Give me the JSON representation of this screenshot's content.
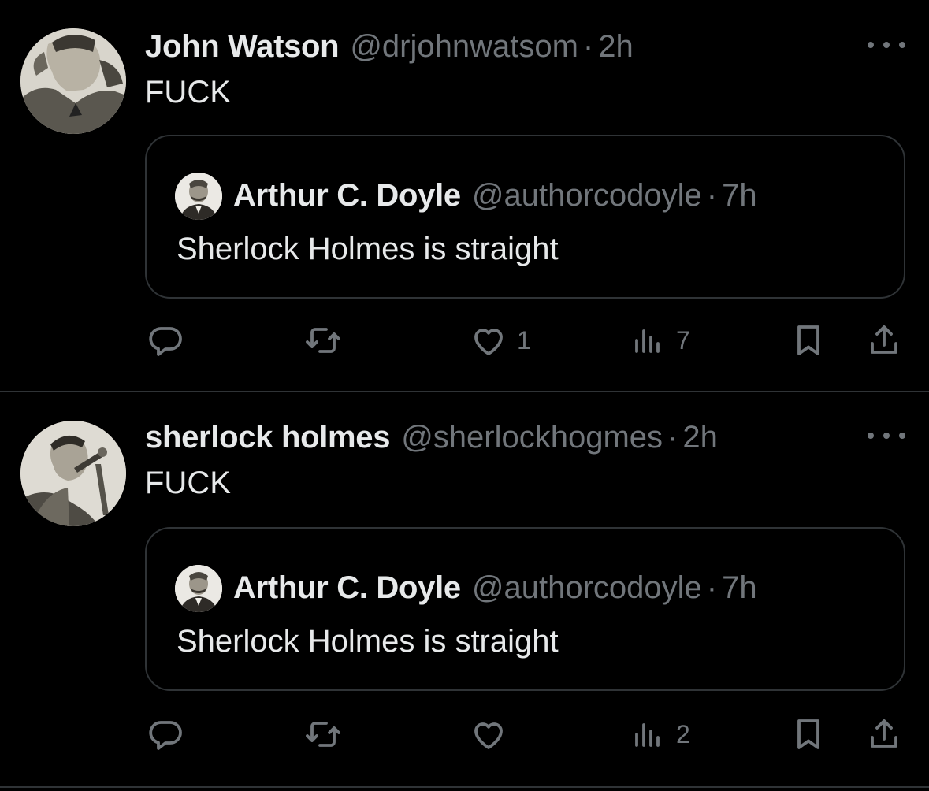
{
  "tweets": [
    {
      "author_name": "John Watson",
      "handle": "@drjohnwatsom",
      "separator": "·",
      "time": "2h",
      "text": "FUCK",
      "quote": {
        "author_name": "Arthur C. Doyle",
        "handle": "@authorcodoyle",
        "separator": "·",
        "time": "7h",
        "text": "Sherlock Holmes is straight"
      },
      "actions": {
        "reply_count": "",
        "retweet_count": "",
        "like_count": "1",
        "views_count": "7"
      }
    },
    {
      "author_name": "sherlock holmes",
      "handle": "@sherlockhogmes",
      "separator": "·",
      "time": "2h",
      "text": "FUCK",
      "quote": {
        "author_name": "Arthur C. Doyle",
        "handle": "@authorcodoyle",
        "separator": "·",
        "time": "7h",
        "text": "Sherlock Holmes is straight"
      },
      "actions": {
        "reply_count": "",
        "retweet_count": "",
        "like_count": "",
        "views_count": "2"
      }
    }
  ],
  "icons": [
    "more-icon",
    "reply-icon",
    "retweet-icon",
    "like-icon",
    "views-icon",
    "bookmark-icon",
    "share-icon"
  ],
  "colors": {
    "background": "#000000",
    "primary_text": "#e7e9ea",
    "secondary_text": "#71767b",
    "border": "#2f3336"
  }
}
